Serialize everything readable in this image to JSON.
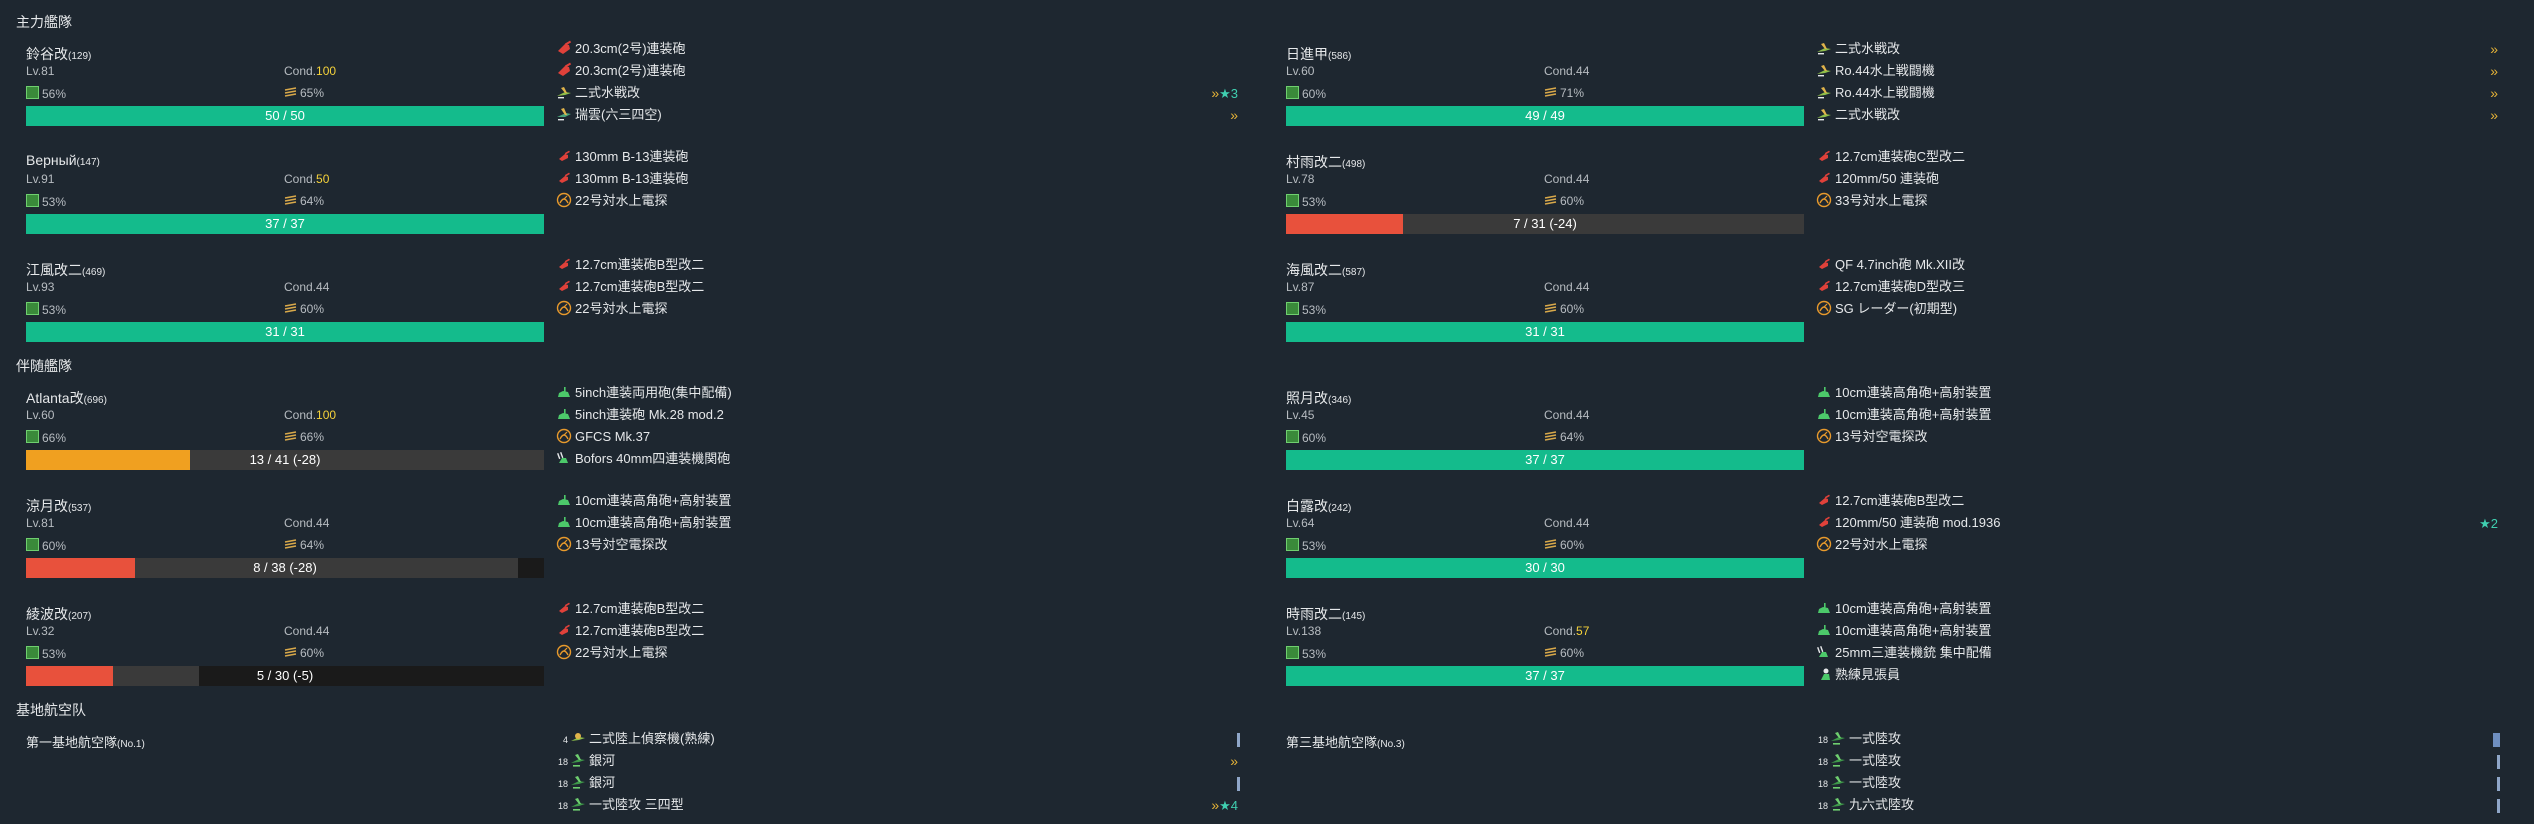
{
  "sections": {
    "main": "主力艦隊",
    "escort": "伴随艦隊",
    "air": "基地航空队"
  },
  "ships": [
    {
      "name": "鈴谷改",
      "id": "(129)",
      "lv": "Lv.81",
      "cond_label": "Cond.",
      "cond": "100",
      "cond_high": true,
      "fuel": "56%",
      "ammo": "65%",
      "hp_text": "50 / 50",
      "hp_ratio": 1.0,
      "hp_color": "#14bb8c",
      "equips": [
        {
          "icon": "heavy-gun-icon",
          "name": "20.3cm(2号)連装砲"
        },
        {
          "icon": "heavy-gun-icon",
          "name": "20.3cm(2号)連装砲"
        },
        {
          "icon": "seaplane-fighter-icon",
          "name": "二式水戦改",
          "rank": "»",
          "imp": "★3"
        },
        {
          "icon": "seaplane-bomber-icon",
          "name": "瑞雲(六三四空)",
          "rank": "»"
        }
      ]
    },
    {
      "name": "Верный",
      "id": "(147)",
      "lv": "Lv.91",
      "cond_label": "Cond.",
      "cond": "50",
      "cond_high": true,
      "fuel": "53%",
      "ammo": "64%",
      "hp_text": "37 / 37",
      "hp_ratio": 1.0,
      "hp_color": "#14bb8c",
      "equips": [
        {
          "icon": "small-gun-icon",
          "name": "130mm B-13連装砲"
        },
        {
          "icon": "small-gun-icon",
          "name": "130mm B-13連装砲"
        },
        {
          "icon": "radar-icon",
          "name": "22号対水上電探"
        }
      ]
    },
    {
      "name": "江風改二",
      "id": "(469)",
      "lv": "Lv.93",
      "cond_label": "Cond.",
      "cond": "44",
      "cond_high": false,
      "fuel": "53%",
      "ammo": "60%",
      "hp_text": "31 / 31",
      "hp_ratio": 1.0,
      "hp_color": "#14bb8c",
      "equips": [
        {
          "icon": "small-gun-icon",
          "name": "12.7cm連装砲B型改二"
        },
        {
          "icon": "small-gun-icon",
          "name": "12.7cm連装砲B型改二"
        },
        {
          "icon": "radar-icon",
          "name": "22号対水上電探"
        }
      ]
    },
    {
      "name": "日進甲",
      "id": "(586)",
      "lv": "Lv.60",
      "cond_label": "Cond.",
      "cond": "44",
      "cond_high": false,
      "fuel": "60%",
      "ammo": "71%",
      "hp_text": "49 / 49",
      "hp_ratio": 1.0,
      "hp_color": "#14bb8c",
      "equips": [
        {
          "icon": "seaplane-fighter-icon",
          "name": "二式水戦改",
          "rank": "»"
        },
        {
          "icon": "seaplane-fighter-icon",
          "name": "Ro.44水上戦闘機",
          "rank": "»"
        },
        {
          "icon": "seaplane-fighter-icon",
          "name": "Ro.44水上戦闘機",
          "rank": "»"
        },
        {
          "icon": "seaplane-fighter-icon",
          "name": "二式水戦改",
          "rank": "»"
        }
      ]
    },
    {
      "name": "村雨改二",
      "id": "(498)",
      "lv": "Lv.78",
      "cond_label": "Cond.",
      "cond": "44",
      "cond_high": false,
      "fuel": "53%",
      "ammo": "60%",
      "hp_text": "7 / 31 (-24)",
      "hp_ratio": 0.226,
      "hp_color": "#e8513c",
      "equips": [
        {
          "icon": "small-gun-icon",
          "name": "12.7cm連装砲C型改二"
        },
        {
          "icon": "small-gun-icon",
          "name": "120mm/50 連装砲"
        },
        {
          "icon": "radar-icon",
          "name": "33号対水上電探"
        }
      ]
    },
    {
      "name": "海風改二",
      "id": "(587)",
      "lv": "Lv.87",
      "cond_label": "Cond.",
      "cond": "44",
      "cond_high": false,
      "fuel": "53%",
      "ammo": "60%",
      "hp_text": "31 / 31",
      "hp_ratio": 1.0,
      "hp_color": "#14bb8c",
      "equips": [
        {
          "icon": "small-gun-icon",
          "name": "QF 4.7inch砲 Mk.XII改"
        },
        {
          "icon": "small-gun-icon",
          "name": "12.7cm連装砲D型改三"
        },
        {
          "icon": "radar-icon",
          "name": "SG レーダー(初期型)"
        }
      ]
    },
    {
      "name": "Atlanta改",
      "id": "(696)",
      "lv": "Lv.60",
      "cond_label": "Cond.",
      "cond": "100",
      "cond_high": true,
      "fuel": "66%",
      "ammo": "66%",
      "hp_text": "13 / 41 (-28)",
      "hp_ratio": 0.317,
      "hp_color": "#f0a020",
      "equips": [
        {
          "icon": "aa-gun-icon",
          "name": "5inch連装両用砲(集中配備)"
        },
        {
          "icon": "aa-gun-icon",
          "name": "5inch連装砲 Mk.28 mod.2"
        },
        {
          "icon": "radar-icon",
          "name": "GFCS Mk.37"
        },
        {
          "icon": "aa-machine-gun-icon",
          "name": "Bofors 40mm四連装機関砲"
        }
      ]
    },
    {
      "name": "涼月改",
      "id": "(537)",
      "lv": "Lv.81",
      "cond_label": "Cond.",
      "cond": "44",
      "cond_high": false,
      "fuel": "60%",
      "ammo": "64%",
      "hp_text": "8 / 38 (-28)",
      "hp_ratio": 0.21,
      "hp_color": "#e8513c",
      "dark_ratio": 0.05,
      "equips": [
        {
          "icon": "aa-gun-icon",
          "name": "10cm連装高角砲+高射装置"
        },
        {
          "icon": "aa-gun-icon",
          "name": "10cm連装高角砲+高射装置"
        },
        {
          "icon": "radar-icon",
          "name": "13号対空電探改"
        }
      ]
    },
    {
      "name": "綾波改",
      "id": "(207)",
      "lv": "Lv.32",
      "cond_label": "Cond.",
      "cond": "44",
      "cond_high": false,
      "fuel": "53%",
      "ammo": "60%",
      "hp_text": "5 / 30 (-5)",
      "hp_ratio": 0.167,
      "hp_color": "#e8513c",
      "dark_ratio": 0.667,
      "equips": [
        {
          "icon": "small-gun-icon",
          "name": "12.7cm連装砲B型改二"
        },
        {
          "icon": "small-gun-icon",
          "name": "12.7cm連装砲B型改二"
        },
        {
          "icon": "radar-icon",
          "name": "22号対水上電探"
        }
      ]
    },
    {
      "name": "照月改",
      "id": "(346)",
      "lv": "Lv.45",
      "cond_label": "Cond.",
      "cond": "44",
      "cond_high": false,
      "fuel": "60%",
      "ammo": "64%",
      "hp_text": "37 / 37",
      "hp_ratio": 1.0,
      "hp_color": "#14bb8c",
      "equips": [
        {
          "icon": "aa-gun-icon",
          "name": "10cm連装高角砲+高射装置"
        },
        {
          "icon": "aa-gun-icon",
          "name": "10cm連装高角砲+高射装置"
        },
        {
          "icon": "radar-icon",
          "name": "13号対空電探改"
        }
      ]
    },
    {
      "name": "白露改",
      "id": "(242)",
      "lv": "Lv.64",
      "cond_label": "Cond.",
      "cond": "44",
      "cond_high": false,
      "fuel": "53%",
      "ammo": "60%",
      "hp_text": "30 / 30",
      "hp_ratio": 1.0,
      "hp_color": "#14bb8c",
      "equips": [
        {
          "icon": "small-gun-icon",
          "name": "12.7cm連装砲B型改二"
        },
        {
          "icon": "small-gun-icon",
          "name": "120mm/50 連装砲 mod.1936",
          "imp": "★2"
        },
        {
          "icon": "radar-icon",
          "name": "22号対水上電探"
        }
      ]
    },
    {
      "name": "時雨改二",
      "id": "(145)",
      "lv": "Lv.138",
      "cond_label": "Cond.",
      "cond": "57",
      "cond_high": true,
      "fuel": "53%",
      "ammo": "60%",
      "hp_text": "37 / 37",
      "hp_ratio": 1.0,
      "hp_color": "#14bb8c",
      "equips": [
        {
          "icon": "aa-gun-icon",
          "name": "10cm連装高角砲+高射装置"
        },
        {
          "icon": "aa-gun-icon",
          "name": "10cm連装高角砲+高射装置"
        },
        {
          "icon": "aa-machine-gun-icon",
          "name": "25mm三連装機銃 集中配備"
        },
        {
          "icon": "lookout-icon",
          "name": "熟練見張員"
        }
      ]
    }
  ],
  "air_bases": [
    {
      "name": "第一基地航空隊",
      "id": "(No.1)",
      "equips": [
        {
          "slot": "4",
          "icon": "land-recon-icon",
          "name": "二式陸上偵察機(熟練)",
          "prof": "bar"
        },
        {
          "slot": "18",
          "icon": "land-bomber-icon",
          "name": "銀河",
          "rank": "»"
        },
        {
          "slot": "18",
          "icon": "land-bomber-icon",
          "name": "銀河",
          "prof": "bar"
        },
        {
          "slot": "18",
          "icon": "land-bomber-icon",
          "name": "一式陸攻 三四型",
          "rank": "»",
          "imp": "★4"
        }
      ]
    },
    {
      "name": "第三基地航空隊",
      "id": "(No.3)",
      "equips": [
        {
          "slot": "18",
          "icon": "land-bomber-icon",
          "name": "一式陸攻",
          "prof": "wide"
        },
        {
          "slot": "18",
          "icon": "land-bomber-icon",
          "name": "一式陸攻",
          "prof": "bar"
        },
        {
          "slot": "18",
          "icon": "land-bomber-icon",
          "name": "一式陸攻",
          "prof": "bar"
        },
        {
          "slot": "18",
          "icon": "land-bomber-icon",
          "name": "九六式陸攻",
          "prof": "bar"
        }
      ]
    }
  ]
}
